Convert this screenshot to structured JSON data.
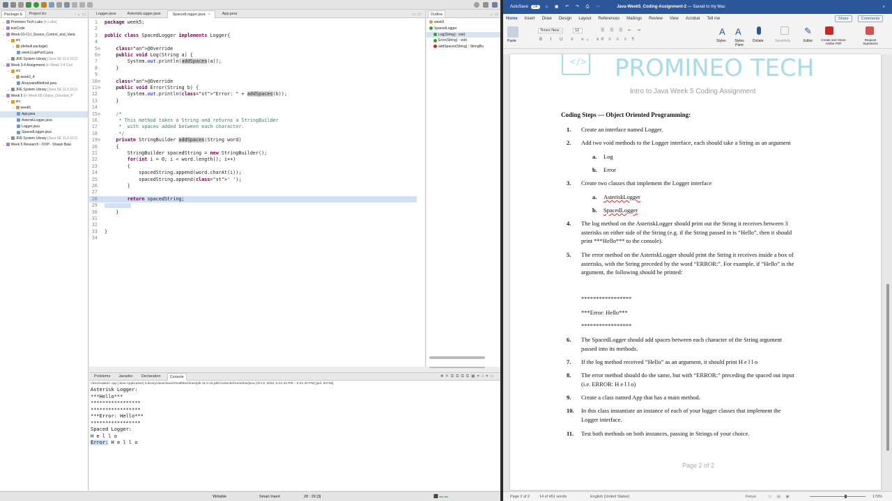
{
  "eclipse": {
    "views": {
      "package_explorer": "Package E",
      "project_explorer": "Project Ex",
      "outline": "Outline"
    },
    "tree": [
      {
        "label": "Promineo Tech Labs",
        "tag": " [in Labs]",
        "indent": 0
      },
      {
        "label": "testCode",
        "tag": "",
        "indent": 0
      },
      {
        "label": "Week-01-CLI_Source_Control_and_Varia",
        "tag": "",
        "indent": 0
      },
      {
        "label": "src",
        "tag": "",
        "indent": 1
      },
      {
        "label": "(default package)",
        "tag": "",
        "indent": 2
      },
      {
        "label": "week1LabPart1.java",
        "tag": "",
        "indent": 3
      },
      {
        "label": "JRE System Library",
        "tag": " [Java SE 11.0.16 [1",
        "indent": 1
      },
      {
        "label": "Week 3-4 Assignment",
        "tag": " [in Week 3-4 Cod",
        "indent": 0
      },
      {
        "label": "src",
        "tag": "",
        "indent": 1
      },
      {
        "label": "week3_4",
        "tag": "",
        "indent": 2
      },
      {
        "label": "ArraysandMethod.java",
        "tag": "",
        "indent": 3
      },
      {
        "label": "JRE System Library",
        "tag": " [Java SE 11.0.16 [1",
        "indent": 1
      },
      {
        "label": "Week 5",
        "tag": " [in Week-05-Object_Oriented_P",
        "indent": 0
      },
      {
        "label": "src",
        "tag": "",
        "indent": 1
      },
      {
        "label": "week5",
        "tag": "",
        "indent": 2
      },
      {
        "label": "App.java",
        "tag": "",
        "indent": 3,
        "selected": true
      },
      {
        "label": "AsteriskLogger.java",
        "tag": "",
        "indent": 3
      },
      {
        "label": "Logger.java",
        "tag": "",
        "indent": 3
      },
      {
        "label": "SpacedLogger.java",
        "tag": "",
        "indent": 3
      },
      {
        "label": "JRE System Library",
        "tag": " [Java SE 11.0.16 [1",
        "indent": 1
      },
      {
        "label": "Week 5 Research - OOP - Shawn Bala",
        "tag": "",
        "indent": 0
      }
    ],
    "editor_tabs": [
      "Logger.java",
      "AsteriskLogger.java",
      "SpacedLogger.java",
      "App.java"
    ],
    "code": [
      "package week5;",
      "",
      "public class SpacedLogger implements Logger{",
      "",
      "    @Override",
      "    public void Log(String a) {",
      "        System.out.println(addSpaces(a));",
      "    }",
      "",
      "    @Override",
      "    public void Error(String b) {",
      "        System.out.println(\"Error: \" + addSpaces(b));",
      "    }",
      "",
      "    /*",
      "     * This method takes a String and returns a StringBuilder",
      "     *  with spaces added between each character.",
      "     */",
      "    private StringBuilder addSpaces(String word)",
      "    {",
      "        StringBuilder spacedString = new StringBuilder();",
      "        for(int i = 0; i < word.length(); i++)",
      "        {",
      "            spacedString.append(word.charAt(i));",
      "            spacedString.append(' ');",
      "        }",
      "",
      "        return spacedString;",
      "",
      "    }",
      "",
      "",
      "}",
      ""
    ],
    "outline": [
      {
        "label": "week5",
        "indent": 0
      },
      {
        "label": "SpacedLogger",
        "indent": 0
      },
      {
        "label": "Log(String) : void",
        "indent": 1
      },
      {
        "label": "Error(String) : void",
        "indent": 1
      },
      {
        "label": "addSpaces(String) : StringBu",
        "indent": 1
      }
    ],
    "console_tabs": [
      "Problems",
      "Javadoc",
      "Declaration",
      "Console"
    ],
    "console_terminated": "<terminated> App [Java Application] /Library/Java/JavaVirtualMachines/jdk-11.0.16.jdk/Contents/Home/bin/java (Oct 8, 2022, 5:31:34 PM – 5:31:34 PM) [pid: 83745]",
    "console_output": [
      "Asterisk Logger:",
      "***Hello***",
      "*****************",
      "*****************",
      "***Error: Hello***",
      "*****************",
      "",
      "Spaced Logger:",
      "H e l l o",
      "Error: H e l l o"
    ],
    "status": {
      "writable": "Writable",
      "insert": "Smart Insert",
      "position": "28 : 29 [3]"
    }
  },
  "word": {
    "autosave": "AutoSave",
    "toggle_state": "Off",
    "doc_title": "Java-Week5_Coding-Assignment-2",
    "saved_status": "Saved to my Mac",
    "share": "Share",
    "comments": "Comments",
    "tabs": [
      "Home",
      "Insert",
      "Draw",
      "Design",
      "Layout",
      "References",
      "Mailings",
      "Review",
      "View",
      "Acrobat",
      "Tell me"
    ],
    "font_name": "Times New...",
    "font_size": "12",
    "ribbon_buttons": [
      "Paste",
      "Styles",
      "Styles Pane",
      "Dictate",
      "Sensitivity",
      "Editor",
      "Create and Share Adobe PDF",
      "Request Signatures"
    ],
    "logo_text": "PROMINEO TECH",
    "subtitle": "Intro to Java Week 5 Coding Assignment",
    "heading": "Coding Steps — Object Oriented Programming:",
    "steps": [
      {
        "n": "1.",
        "text": [
          "Create an interface named Logger."
        ]
      },
      {
        "n": "2.",
        "text": [
          "Add two void methods to the Logger interface, each should take a String as an argument"
        ]
      },
      {
        "n": "3.",
        "text": [
          "Create two classes that implement the Logger interface"
        ]
      },
      {
        "n": "4.",
        "text": [
          "The log method on the AsteriskLogger should print out the String it receives between 3",
          "asterisks on either side of the String (e.g. if the String passed in is “Hello”, then it should",
          "print ***Hello*** to the console)."
        ]
      },
      {
        "n": "5.",
        "text": [
          "The error method on the AsteriskLogger should print the String it receives inside a box of",
          "asterisks, with the String preceded by the word “ERROR:”. For example, if “Hello” is the",
          "argument, the following should be printed:"
        ]
      },
      {
        "n": "6.",
        "text": [
          "The SpacedLogger should add spaces between each character of the String argument",
          "passed into its methods."
        ]
      },
      {
        "n": "7.",
        "text": [
          "If the log method received “Hello” as an argument, it should print H e l l o"
        ]
      },
      {
        "n": "8.",
        "text": [
          "The error method should do the same, but with “ERROR:” preceding the spaced out input",
          "(i.e. ERROR: H e l l o)"
        ]
      },
      {
        "n": "9.",
        "text": [
          "Create a class named App that has a main method."
        ]
      },
      {
        "n": "10.",
        "text": [
          "In this class instantiate an instance of each of your logger classes that implement the",
          "Logger interface."
        ]
      },
      {
        "n": "11.",
        "text": [
          "Test both methods on both instances, passing in Strings of your choice."
        ]
      }
    ],
    "sub2": [
      {
        "n": "a.",
        "text": "Log"
      },
      {
        "n": "b.",
        "text": "Error"
      }
    ],
    "sub3": [
      {
        "n": "a.",
        "text": "AsteriskLogger"
      },
      {
        "n": "b.",
        "text": "SpacedLogger"
      }
    ],
    "example_box": [
      "*****************",
      "***Error: Hello***",
      "*****************"
    ],
    "page_footer": "Page 2 of 2",
    "status": {
      "page": "Page 2 of 2",
      "words": "14 of 451 words",
      "language": "English (United States)",
      "focus": "Focus",
      "zoom": "170%"
    }
  }
}
